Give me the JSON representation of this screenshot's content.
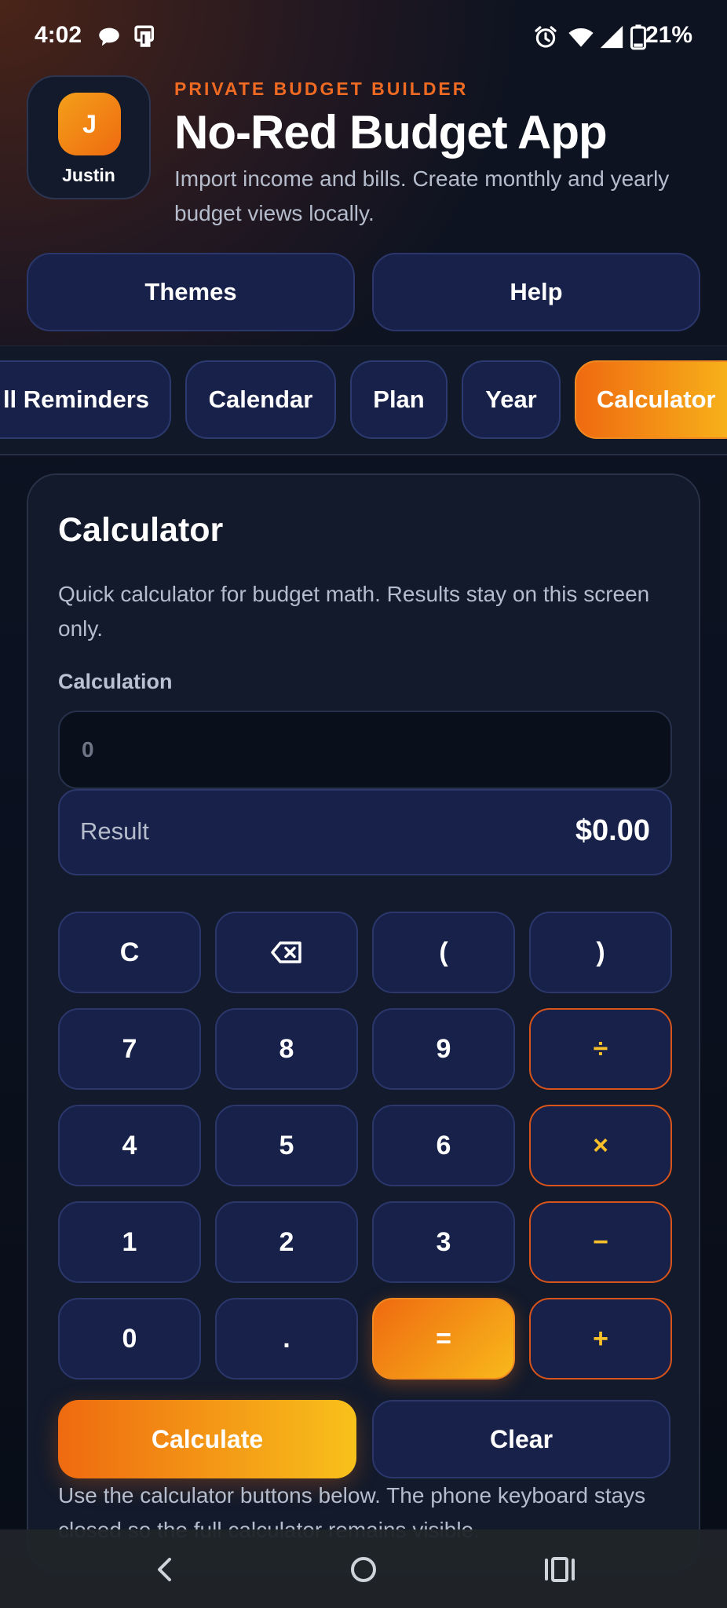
{
  "status_bar": {
    "time": "4:02",
    "battery": "21%",
    "icons": [
      "chat-bubble-icon",
      "cast-icon",
      "alarm-icon",
      "wifi-icon",
      "signal-icon",
      "battery-icon"
    ]
  },
  "header": {
    "avatar_initial": "J",
    "user_name": "Justin",
    "eyebrow": "PRIVATE BUDGET BUILDER",
    "title": "No-Red Budget App",
    "subtitle": "Import income and bills. Create monthly and yearly budget views locally."
  },
  "top_buttons": {
    "themes": "Themes",
    "help": "Help"
  },
  "tabs": [
    {
      "label": "ll Reminders"
    },
    {
      "label": "Calendar"
    },
    {
      "label": "Plan"
    },
    {
      "label": "Year"
    },
    {
      "label": "Calculator",
      "active": true
    }
  ],
  "calculator": {
    "title": "Calculator",
    "description": "Quick calculator for budget math. Results stay on this screen only.",
    "field_label": "Calculation",
    "input_placeholder": "0",
    "input_value": "",
    "result_label": "Result",
    "result_value": "$0.00",
    "keys": {
      "clear": "C",
      "backspace": "⌫",
      "open_paren": "(",
      "close_paren": ")",
      "seven": "7",
      "eight": "8",
      "nine": "9",
      "divide": "÷",
      "four": "4",
      "five": "5",
      "six": "6",
      "multiply": "×",
      "one": "1",
      "two": "2",
      "three": "3",
      "subtract": "−",
      "zero": "0",
      "decimal": ".",
      "equals": "=",
      "add": "+"
    },
    "calculate_label": "Calculate",
    "clear_label": "Clear",
    "hint": "Use the calculator buttons below. The phone keyboard stays closed so the full calculator remains visible."
  },
  "colors": {
    "accent": "#ef6a10",
    "accent_end": "#f8b91b",
    "button_bg": "#17214a",
    "card_bg": "#121a2b"
  },
  "nav_bar": {
    "icons": [
      "back-icon",
      "home-icon",
      "recents-icon"
    ]
  }
}
